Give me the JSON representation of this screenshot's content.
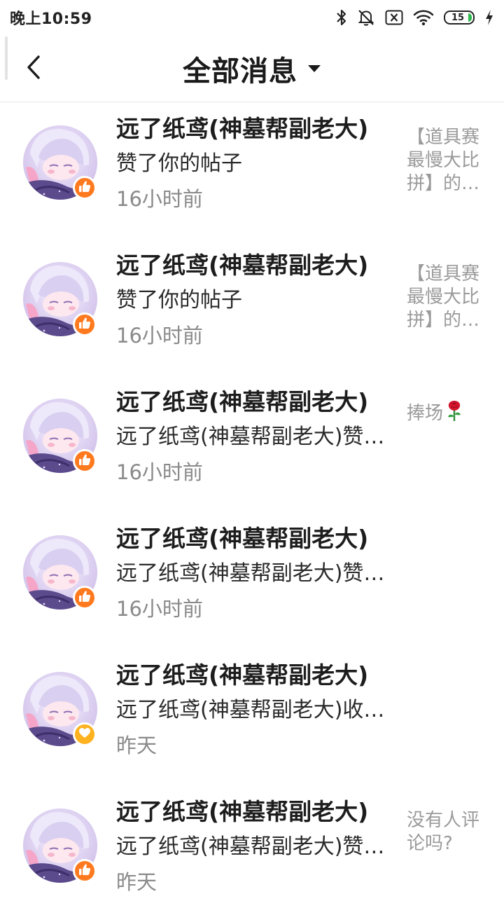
{
  "status_bar": {
    "time": "晚上10:59",
    "battery_level": "15",
    "icons": [
      "bluetooth-icon",
      "mute-bell-icon",
      "sim-off-icon",
      "wifi-icon",
      "battery-icon",
      "charging-icon"
    ]
  },
  "header": {
    "title": "全部消息",
    "back_icon": "back-arrow-icon",
    "dropdown_icon": "caret-down-icon"
  },
  "colors": {
    "like_badge": "#ff7a1f",
    "heart_badge": "#ffb21f",
    "time_text": "#8a8a8a",
    "preview_text": "#9a9a9a"
  },
  "messages": [
    {
      "name": "远了纸鸢(神墓帮副老大)",
      "action": "赞了你的帖子",
      "time": "16小时前",
      "preview": "【道具赛最慢大比拼】的帖子",
      "badge": "like-icon"
    },
    {
      "name": "远了纸鸢(神墓帮副老大)",
      "action": "赞了你的帖子",
      "time": "16小时前",
      "preview": "【道具赛最慢大比拼】的帖子",
      "badge": "like-icon"
    },
    {
      "name": "远了纸鸢(神墓帮副老大)",
      "action": "远了纸鸢(神墓帮副老大)赞了你的评论",
      "time": "16小时前",
      "preview": "捧场",
      "preview_icon": "rose-icon",
      "badge": "like-icon"
    },
    {
      "name": "远了纸鸢(神墓帮副老大)",
      "action": "远了纸鸢(神墓帮副老大)赞了你的评论",
      "time": "16小时前",
      "preview": "",
      "badge": "like-icon"
    },
    {
      "name": "远了纸鸢(神墓帮副老大)",
      "action": "远了纸鸢(神墓帮副老大)收藏了你的帖子",
      "time": "昨天",
      "preview": "",
      "badge": "heart-icon"
    },
    {
      "name": "远了纸鸢(神墓帮副老大)",
      "action": "远了纸鸢(神墓帮副老大)赞了你的评论",
      "time": "昨天",
      "preview": "没有人评论吗?",
      "badge": "like-icon"
    }
  ]
}
